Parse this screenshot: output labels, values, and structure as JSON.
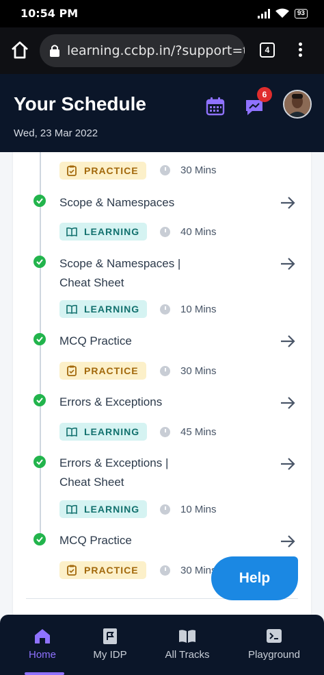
{
  "status_bar": {
    "time": "10:54 PM",
    "battery": "93"
  },
  "browser": {
    "url": "learning.ccbp.in/?support=t",
    "tab_count": "4"
  },
  "header": {
    "title": "Your Schedule",
    "date": "Wed, 23 Mar 2022",
    "notification_count": "6"
  },
  "schedule": {
    "items": [
      {
        "title_line1": "",
        "title_line2": "",
        "tag": "PRACTICE",
        "duration": "30 Mins"
      },
      {
        "title_line1": "Scope & Namespaces",
        "title_line2": "",
        "tag": "LEARNING",
        "duration": "40 Mins"
      },
      {
        "title_line1": "Scope & Namespaces |",
        "title_line2": "Cheat Sheet",
        "tag": "LEARNING",
        "duration": "10 Mins"
      },
      {
        "title_line1": "MCQ Practice",
        "title_line2": "",
        "tag": "PRACTICE",
        "duration": "30 Mins"
      },
      {
        "title_line1": "Errors & Exceptions",
        "title_line2": "",
        "tag": "LEARNING",
        "duration": "45 Mins"
      },
      {
        "title_line1": "Errors & Exceptions |",
        "title_line2": "Cheat Sheet",
        "tag": "LEARNING",
        "duration": "10 Mins"
      },
      {
        "title_line1": "MCQ Practice",
        "title_line2": "",
        "tag": "PRACTICE",
        "duration": "30 Mins"
      }
    ]
  },
  "help_button": {
    "label": "Help"
  },
  "bottom_nav": {
    "items": [
      {
        "label": "Home",
        "icon": "home-icon",
        "active": true
      },
      {
        "label": "My IDP",
        "icon": "idp-icon",
        "active": false
      },
      {
        "label": "All Tracks",
        "icon": "book-icon",
        "active": false
      },
      {
        "label": "Playground",
        "icon": "terminal-icon",
        "active": false
      }
    ]
  },
  "colors": {
    "accent": "#8f72ff",
    "header_bg": "#0b1629",
    "check_green": "#22b44c",
    "help_blue": "#1b88e3"
  }
}
